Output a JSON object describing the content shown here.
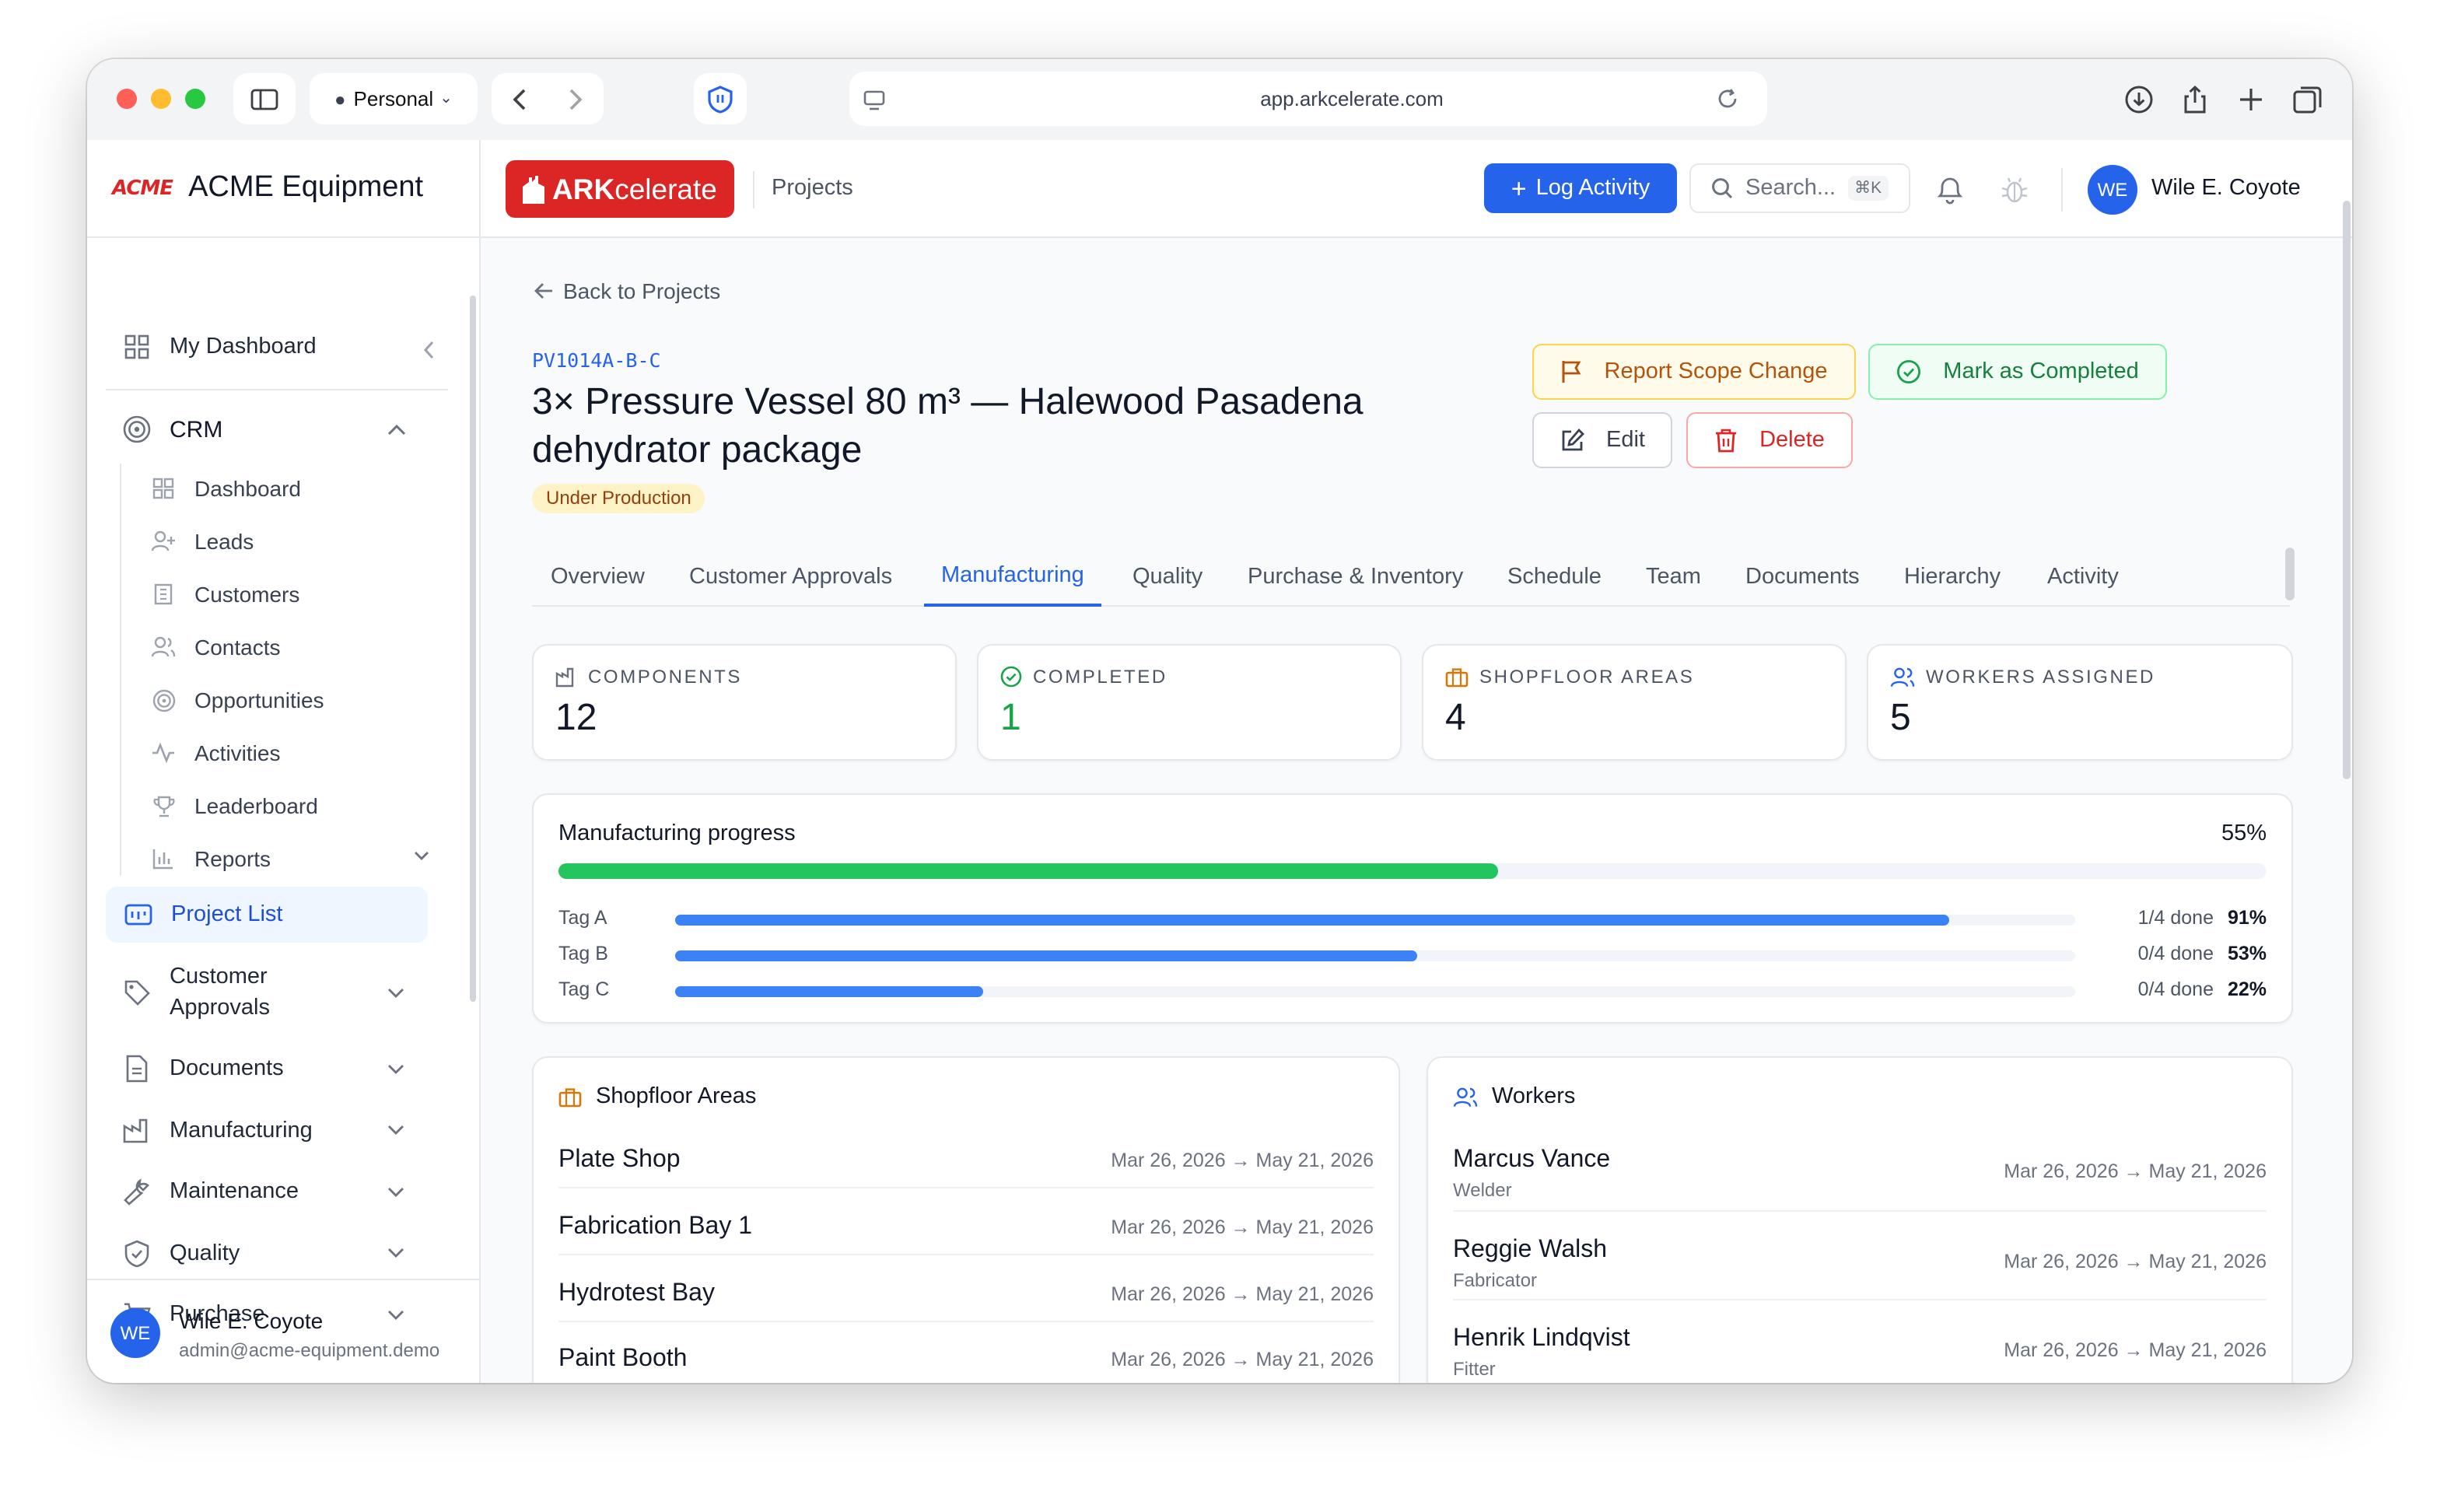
{
  "browser": {
    "profile": "Personal",
    "url": "app.arkcelerate.com"
  },
  "sidebar": {
    "logo_text": "ACME",
    "company": "ACME Equipment",
    "dashboard": "My Dashboard",
    "crm": {
      "label": "CRM",
      "items": [
        "Dashboard",
        "Leads",
        "Customers",
        "Contacts",
        "Opportunities",
        "Activities",
        "Leaderboard",
        "Reports"
      ]
    },
    "project_list": "Project List",
    "sections": [
      "Customer Approvals",
      "Documents",
      "Manufacturing",
      "Maintenance",
      "Quality",
      "Purchase"
    ],
    "user": {
      "initials": "WE",
      "name": "Wile E. Coyote",
      "email": "admin@acme-equipment.demo"
    }
  },
  "topbar": {
    "brand_prefix": "ARK",
    "brand_suffix": "celerate",
    "breadcrumb": "Projects",
    "log_activity": "Log Activity",
    "search_placeholder": "Search...",
    "search_shortcut": "⌘K",
    "user_initials": "WE",
    "user_name": "Wile E. Coyote"
  },
  "project": {
    "back": "Back to Projects",
    "code": "PV1014A-B-C",
    "title_line1": "3× Pressure Vessel 80 m³ — Halewood Pasadena",
    "title_line2": "dehydrator package",
    "status": "Under Production",
    "actions": {
      "scope_change": "Report Scope Change",
      "mark_completed": "Mark as Completed",
      "edit": "Edit",
      "delete": "Delete"
    }
  },
  "tabs": [
    "Overview",
    "Customer Approvals",
    "Manufacturing",
    "Quality",
    "Purchase & Inventory",
    "Schedule",
    "Team",
    "Documents",
    "Hierarchy",
    "Activity"
  ],
  "active_tab": "Manufacturing",
  "stats": [
    {
      "label": "COMPONENTS",
      "value": "12",
      "icon": "factory-icon"
    },
    {
      "label": "COMPLETED",
      "value": "1",
      "icon": "check-circle-icon"
    },
    {
      "label": "SHOPFLOOR AREAS",
      "value": "4",
      "icon": "briefcase-icon"
    },
    {
      "label": "WORKERS ASSIGNED",
      "value": "5",
      "icon": "users-icon"
    }
  ],
  "progress": {
    "title": "Manufacturing progress",
    "overall_label": "55%",
    "overall": 0.55,
    "tags": [
      {
        "name": "Tag A",
        "done": "1/4 done",
        "pct_label": "91%",
        "pct": 0.91
      },
      {
        "name": "Tag B",
        "done": "0/4 done",
        "pct_label": "53%",
        "pct": 0.53
      },
      {
        "name": "Tag C",
        "done": "0/4 done",
        "pct_label": "22%",
        "pct": 0.22
      }
    ]
  },
  "shopfloor": {
    "title": "Shopfloor Areas",
    "rows": [
      {
        "name": "Plate Shop",
        "dates": "Mar 26, 2026 → May 21, 2026"
      },
      {
        "name": "Fabrication Bay 1",
        "dates": "Mar 26, 2026 → May 21, 2026"
      },
      {
        "name": "Hydrotest Bay",
        "dates": "Mar 26, 2026 → May 21, 2026"
      },
      {
        "name": "Paint Booth",
        "dates": "Mar 26, 2026 → May 21, 2026"
      }
    ]
  },
  "workers": {
    "title": "Workers",
    "rows": [
      {
        "name": "Marcus Vance",
        "role": "Welder",
        "dates": "Mar 26, 2026 → May 21, 2026"
      },
      {
        "name": "Reggie Walsh",
        "role": "Fabricator",
        "dates": "Mar 26, 2026 → May 21, 2026"
      },
      {
        "name": "Henrik Lindqvist",
        "role": "Fitter",
        "dates": "Mar 26, 2026 → May 21, 2026"
      }
    ]
  },
  "colors": {
    "brand_red": "#dc2626",
    "primary_blue": "#2563eb",
    "progress_green": "#22c55e",
    "status_amber_bg": "#fef3c7",
    "completed_green": "#16a34a"
  }
}
